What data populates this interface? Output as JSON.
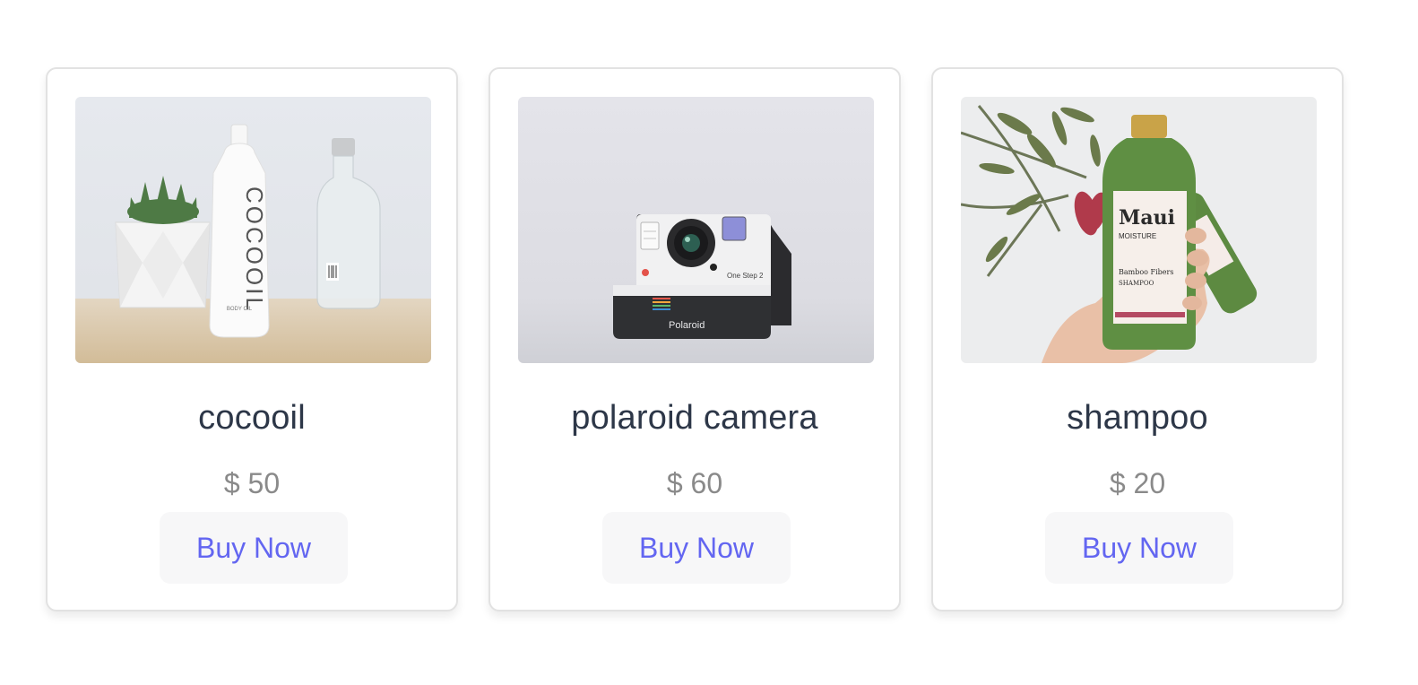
{
  "products": [
    {
      "name": "cocooil",
      "price": "$ 50",
      "buy_label": "Buy Now",
      "image_alt": "cocooil",
      "bottle_brand": "COCOOIL",
      "bottle_sub": "BODY OIL"
    },
    {
      "name": "polaroid camera",
      "price": "$ 60",
      "buy_label": "Buy Now",
      "image_alt": "polaroid camera",
      "camera_brand": "Polaroid",
      "camera_model": "One Step 2"
    },
    {
      "name": "shampoo",
      "price": "$ 20",
      "buy_label": "Buy Now",
      "image_alt": "shampoo",
      "bottle_brand": "Maui",
      "bottle_sub": "MOISTURE",
      "bottle_line1": "Bamboo Fibers",
      "bottle_line2": "SHAMPOO"
    }
  ],
  "colors": {
    "title": "#2d3748",
    "price": "#8a8a8a",
    "button_text": "#6366f1",
    "button_bg": "#f7f7f8",
    "card_border": "#e2e2e2"
  }
}
